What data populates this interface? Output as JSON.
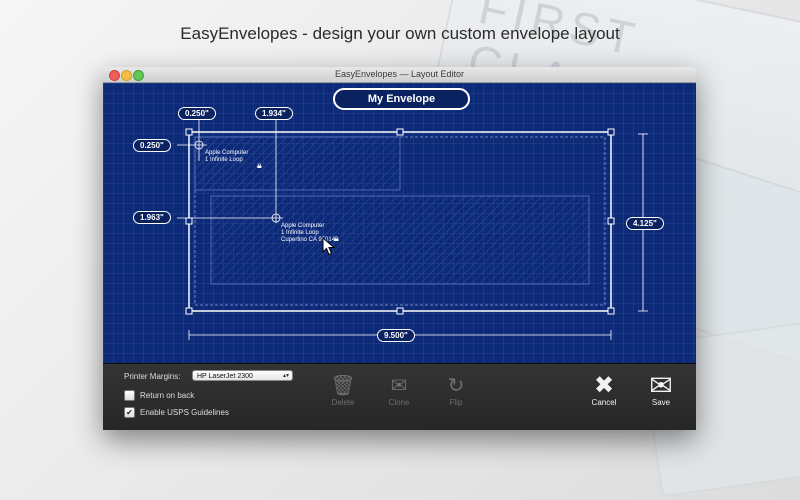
{
  "headline": "EasyEnvelopes - design your own custom envelope layout",
  "background": {
    "stamp_text": "FIRST CLASS"
  },
  "window": {
    "title": "EasyEnvelopes — Layout Editor",
    "envelope_name": "My Envelope",
    "dimensions": {
      "top_left_x": "0.250\"",
      "recipient_x": "1.934\"",
      "top_left_y": "0.250\"",
      "recipient_y": "1.963\"",
      "height": "4.125\"",
      "width": "9.500\""
    },
    "return_address": "Apple Computer\n1 Infinite Loop",
    "recipient_address": "Apple Computer\n1 Infinite Loop\nCupertino CA 95014",
    "toolbar": {
      "printer_margins_label": "Printer Margins:",
      "printer_selected": "HP LaserJet 2300",
      "return_on_back_label": "Return on back",
      "return_on_back_checked": false,
      "usps_label": "Enable USPS Guidelines",
      "usps_checked": true,
      "delete_label": "Delete",
      "clone_label": "Clone",
      "flip_label": "Flip",
      "cancel_label": "Cancel",
      "save_label": "Save"
    }
  },
  "colors": {
    "blueprint": "#0d2a78",
    "toolbar": "#2e2e2e"
  }
}
